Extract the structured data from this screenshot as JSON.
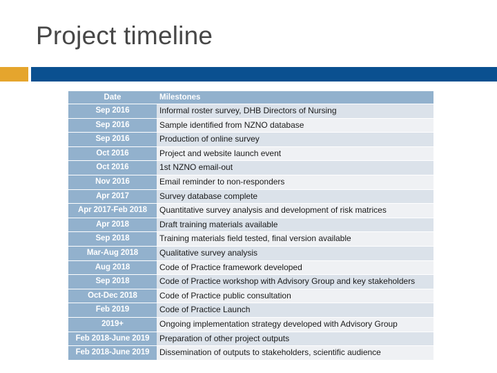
{
  "slide": {
    "title": "Project timeline",
    "accent_orange": "#e5a52d",
    "accent_blue": "#0a5090",
    "title_color": "#474747"
  },
  "table": {
    "header_bg": "#92b1cd",
    "date_cell_bg": "#92b1cd",
    "row_alt_bg_a": "#dbe2ea",
    "row_alt_bg_b": "#eff1f4",
    "columns": [
      "Date",
      "Milestones"
    ],
    "rows": [
      {
        "date": "Sep 2016",
        "milestone": "Informal roster survey, DHB Directors of Nursing"
      },
      {
        "date": "Sep 2016",
        "milestone": "Sample identified from NZNO database"
      },
      {
        "date": "Sep 2016",
        "milestone": "Production of online survey"
      },
      {
        "date": "Oct 2016",
        "milestone": "Project and website launch event"
      },
      {
        "date": "Oct 2016",
        "milestone": "1st NZNO email-out"
      },
      {
        "date": "Nov 2016",
        "milestone": "Email reminder to non-responders"
      },
      {
        "date": "Apr 2017",
        "milestone": "Survey database complete"
      },
      {
        "date": "Apr 2017-Feb 2018",
        "milestone": "Quantitative survey analysis and development of risk matrices"
      },
      {
        "date": "Apr 2018",
        "milestone": "Draft training materials available"
      },
      {
        "date": "Sep 2018",
        "milestone": "Training materials field tested, final version available"
      },
      {
        "date": "Mar-Aug 2018",
        "milestone": "Qualitative survey analysis"
      },
      {
        "date": "Aug 2018",
        "milestone": "Code of Practice framework developed"
      },
      {
        "date": "Sep 2018",
        "milestone": "Code of Practice workshop with Advisory Group and key stakeholders",
        "lines": 2
      },
      {
        "date": "Oct-Dec 2018",
        "milestone": "Code of Practice public consultation"
      },
      {
        "date": "Feb 2019",
        "milestone": "Code of Practice Launch"
      },
      {
        "date": "2019+",
        "milestone": "Ongoing implementation strategy developed with Advisory Group",
        "lines": 2
      },
      {
        "date": "Feb 2018-June 2019",
        "milestone": "Preparation of other project outputs"
      },
      {
        "date": "Feb 2018-June 2019",
        "milestone": "Dissemination of outputs to stakeholders, scientific audience"
      }
    ]
  }
}
